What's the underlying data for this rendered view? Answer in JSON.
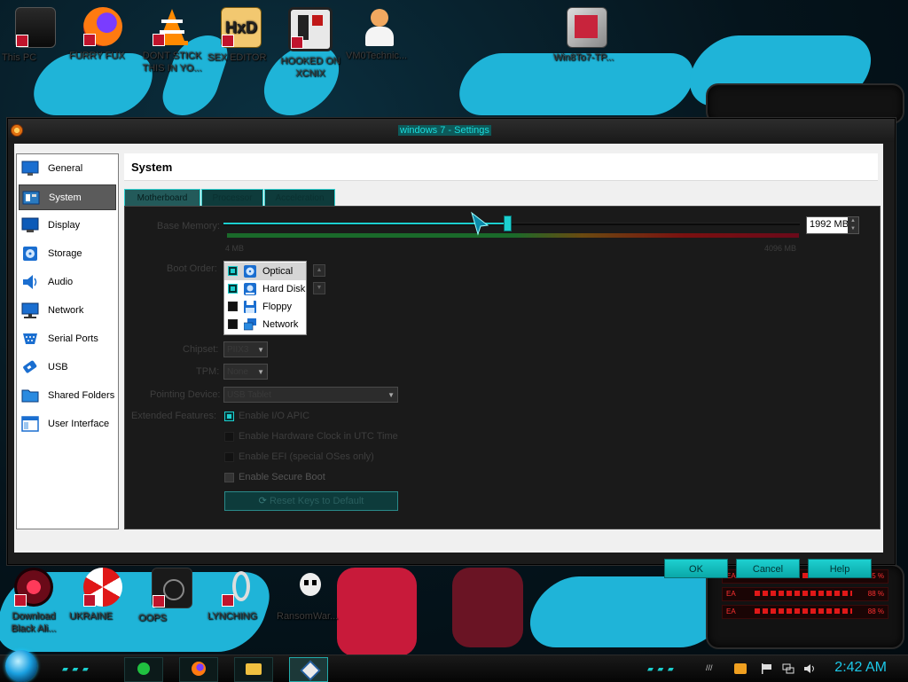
{
  "desktop": {
    "top_icons": [
      {
        "label": "This PC",
        "icon": "computer-icon"
      },
      {
        "label": "FURRY FUX",
        "icon": "firefox-icon"
      },
      {
        "label": "DONT STICK THIS IN YO...",
        "icon": "vlc-icon"
      },
      {
        "label": "SEX EDITOR",
        "icon": "hxd-editor-icon"
      },
      {
        "label": "HOOKED ON XCNIX",
        "icon": "app-icon"
      },
      {
        "label": "VM0Technic...",
        "icon": "doctor-icon"
      },
      {
        "label": "Win8To7-TP...",
        "icon": "package-icon"
      }
    ],
    "bottom_icons": [
      {
        "label": "Download Black Ali...",
        "icon": "eye-icon"
      },
      {
        "label": "UKRAINE",
        "icon": "radiation-icon"
      },
      {
        "label": "OOPS",
        "icon": "glitch-icon"
      },
      {
        "label": "LYNCHING",
        "icon": "rope-icon"
      },
      {
        "label": "RansomWar...",
        "icon": "skull-icon"
      }
    ],
    "gadget_rows": [
      {
        "label": "EA",
        "value": "45 %"
      },
      {
        "label": "EA",
        "value": "88 %"
      },
      {
        "label": "EA",
        "value": "88 %"
      }
    ]
  },
  "window": {
    "title": "windows 7 - Settings"
  },
  "sidebar": {
    "items": [
      {
        "label": "General"
      },
      {
        "label": "System"
      },
      {
        "label": "Display"
      },
      {
        "label": "Storage"
      },
      {
        "label": "Audio"
      },
      {
        "label": "Network"
      },
      {
        "label": "Serial Ports"
      },
      {
        "label": "USB"
      },
      {
        "label": "Shared Folders"
      },
      {
        "label": "User Interface"
      }
    ],
    "selected": "System"
  },
  "panel": {
    "title": "System",
    "tabs": [
      "Motherboard",
      "Processor",
      "Acceleration"
    ],
    "active_tab": "Motherboard"
  },
  "motherboard": {
    "base_memory_label": "Base Memory:",
    "memory_value": "1992 MB",
    "memory_min": "4 MB",
    "memory_max": "4096 MB",
    "memory_fraction": 0.49,
    "boot_order_label": "Boot Order:",
    "boot_items": [
      {
        "label": "Optical",
        "checked": true
      },
      {
        "label": "Hard Disk",
        "checked": true
      },
      {
        "label": "Floppy",
        "checked": false
      },
      {
        "label": "Network",
        "checked": false
      }
    ],
    "chipset_label": "Chipset:",
    "chipset_value": "PIIX3",
    "tpm_label": "TPM:",
    "tpm_value": "None",
    "pointing_label": "Pointing Device:",
    "pointing_value": "USB Tablet",
    "extended_label": "Extended Features:",
    "features": [
      {
        "label": "Enable I/O APIC",
        "checked": true
      },
      {
        "label": "Enable Hardware Clock in UTC Time",
        "checked": false
      },
      {
        "label": "Enable EFI (special OSes only)",
        "checked": false
      },
      {
        "label": "Enable Secure Boot",
        "checked": false
      }
    ],
    "reset_keys_label": "Reset Keys to Default"
  },
  "buttons": {
    "ok": "OK",
    "cancel": "Cancel",
    "help": "Help"
  },
  "taskbar": {
    "time": "2:42 AM"
  },
  "colors": {
    "accent": "#1ccfcf",
    "wallpaper_brush": "#1fb4d8",
    "gadget_red": "#e01818"
  }
}
